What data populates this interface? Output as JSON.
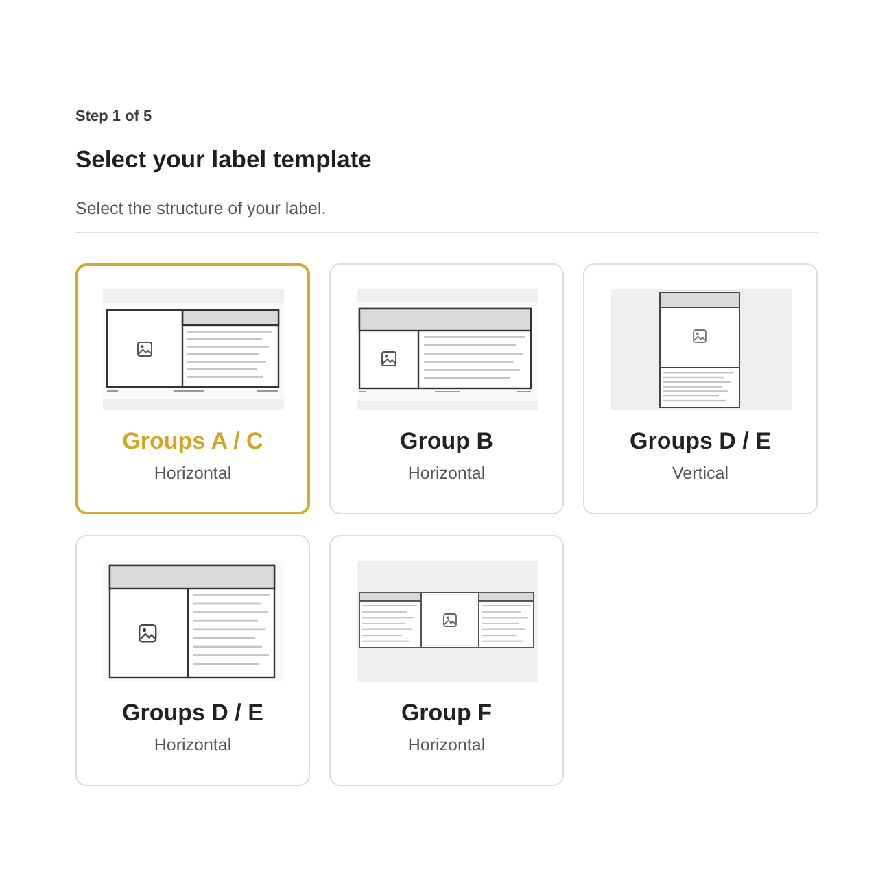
{
  "step": "Step 1 of 5",
  "title": "Select your label template",
  "subtitle": "Select the structure of your label.",
  "templates": [
    {
      "name": "Groups A / C",
      "orientation": "Horizontal",
      "kind": "side-header",
      "selected": true
    },
    {
      "name": "Group B",
      "orientation": "Horizontal",
      "kind": "top-header",
      "selected": false
    },
    {
      "name": "Groups D / E",
      "orientation": "Vertical",
      "kind": "portrait",
      "selected": false
    },
    {
      "name": "Groups D / E",
      "orientation": "Horizontal",
      "kind": "top-header-tall",
      "selected": false
    },
    {
      "name": "Group F",
      "orientation": "Horizontal",
      "kind": "three-panel",
      "selected": false
    }
  ]
}
